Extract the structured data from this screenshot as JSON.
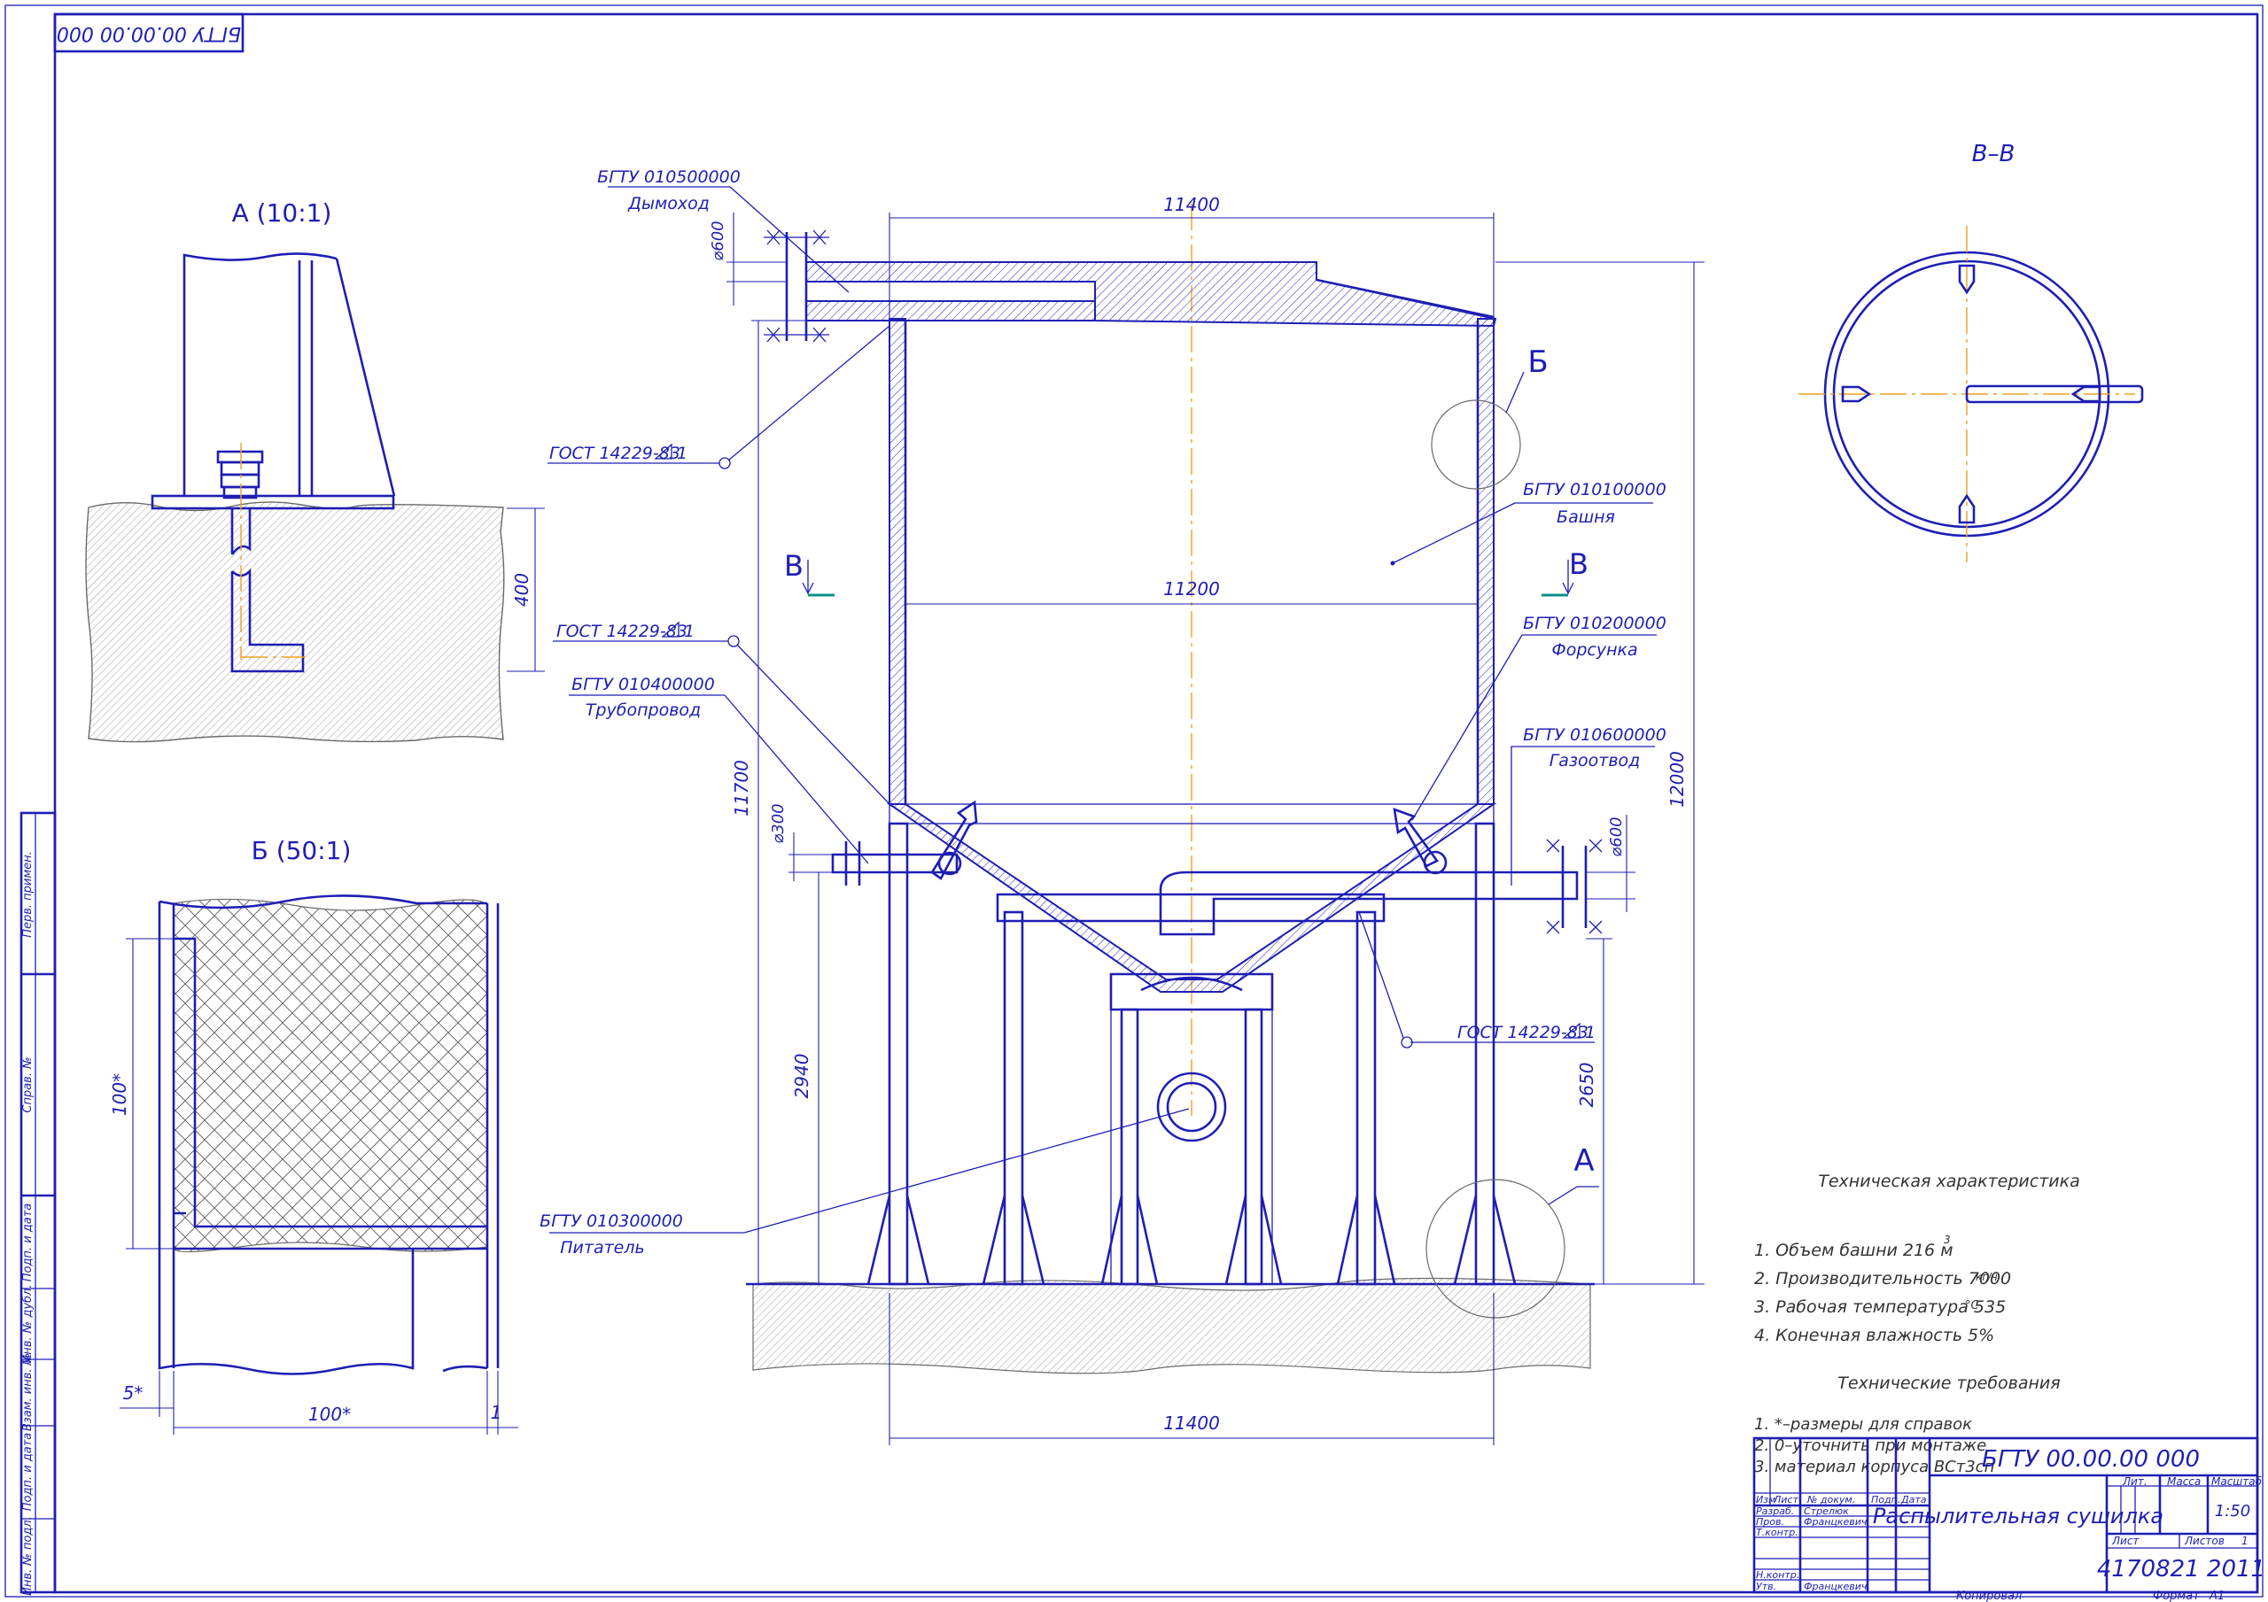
{
  "stamp": {
    "code_rotated": "БГТУ 00.00.00 000"
  },
  "views": {
    "detail_a": {
      "label": "А (10:1)",
      "dim_400": "400"
    },
    "detail_b": {
      "label": "Б (50:1)",
      "dim_100v": "100*",
      "dim_100h": "100*",
      "dim_5": "5*",
      "dim_1": "1"
    },
    "section_bb": {
      "label": "В–В"
    }
  },
  "main": {
    "dim_top": "11400",
    "dim_inner": "11200",
    "dim_bottom": "11400",
    "dim_height_left": "11700",
    "dim_height_right": "12000",
    "dim_2940": "2940",
    "dim_2650": "2650",
    "dim_d600_top": "⌀600",
    "dim_d300": "⌀300",
    "dim_d600_right": "⌀600",
    "mark_b": "Б",
    "mark_a": "А",
    "mark_v_left": "В",
    "mark_v_right": "В"
  },
  "callouts": {
    "chimney_code": "БГТУ 010500000",
    "chimney_name": "Дымоход",
    "gost1": "ГОСТ 14229-83",
    "gost1_num": "1",
    "gost2": "ГОСТ 14229-83",
    "gost2_num": "1",
    "gost3": "ГОСТ 14229-83",
    "gost3_num": "1",
    "pipe_code": "БГТУ 010400000",
    "pipe_name": "Трубопровод",
    "tower_code": "БГТУ 010100000",
    "tower_name": "Башня",
    "nozzle_code": "БГТУ 010200000",
    "nozzle_name": "Форсунка",
    "gas_code": "БГТУ 010600000",
    "gas_name": "Газоотвод",
    "feeder_code": "БГТУ 010300000",
    "feeder_name": "Питатель"
  },
  "notes": {
    "tech_char_title": "Техническая характеристика",
    "char_1": "1. Объем башни 216 м",
    "char_1_sup": "3",
    "char_2": "2. Производительность 7000",
    "char_2_unit": "кг/ч",
    "char_3": "3. Рабочая температура 535",
    "char_3_unit": "°С",
    "char_4": "4. Конечная влажность 5%",
    "tech_req_title": "Технические требования",
    "req_1": "1. *–размеры для справок",
    "req_2": "2. 0–уточнить при монтаже",
    "req_3": "3. материал корпуса ВСт3сп"
  },
  "side_box": [
    "Перв. примен.",
    "Справ. №",
    "Подп. и дата",
    "Инв. № дубл.",
    "Взам. инв. №",
    "Подп. и дата",
    "Инв. № подл."
  ],
  "title_block": {
    "doc_code": "БГТУ 00.00.00 000",
    "title": "Распылительная сушилка",
    "col_izm": "Изм",
    "col_list": "Лист",
    "col_ndoc": "№ докум.",
    "col_podp": "Подп.",
    "col_data": "Дата",
    "row_razrab": "Разраб.",
    "name_razrab": "Стрелюк",
    "row_prov": "Пров.",
    "name_prov": "Францкевич",
    "row_tkontr": "Т.контр.",
    "row_nkontr": "Н.контр.",
    "row_utv": "Утв.",
    "name_utv": "Францкевич",
    "lit": "Лит.",
    "massa": "Масса",
    "masshtab": "Масштаб",
    "scale": "1:50",
    "sheet": "Лист",
    "sheets": "Листов",
    "sheets_num": "1",
    "group": "4170821 2011",
    "kopiroval": "Копировал",
    "format": "Формат",
    "format_val": "А1"
  }
}
